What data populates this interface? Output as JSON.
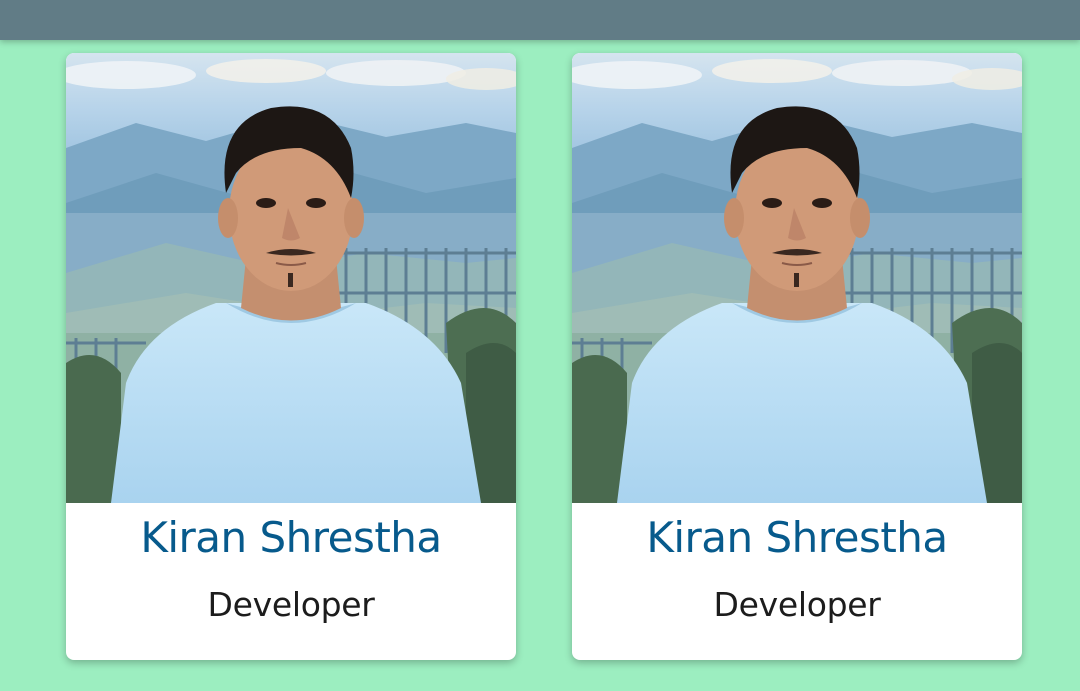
{
  "header": {
    "background": "#617c86"
  },
  "colors": {
    "page_bg": "#9ceec0",
    "name_color": "#075a8c",
    "role_color": "#1c1c1c"
  },
  "team": [
    {
      "name": "Kiran Shrestha",
      "role": "Developer",
      "photo": "person-portrait-photo"
    },
    {
      "name": "Kiran Shrestha",
      "role": "Developer",
      "photo": "person-portrait-photo"
    }
  ]
}
